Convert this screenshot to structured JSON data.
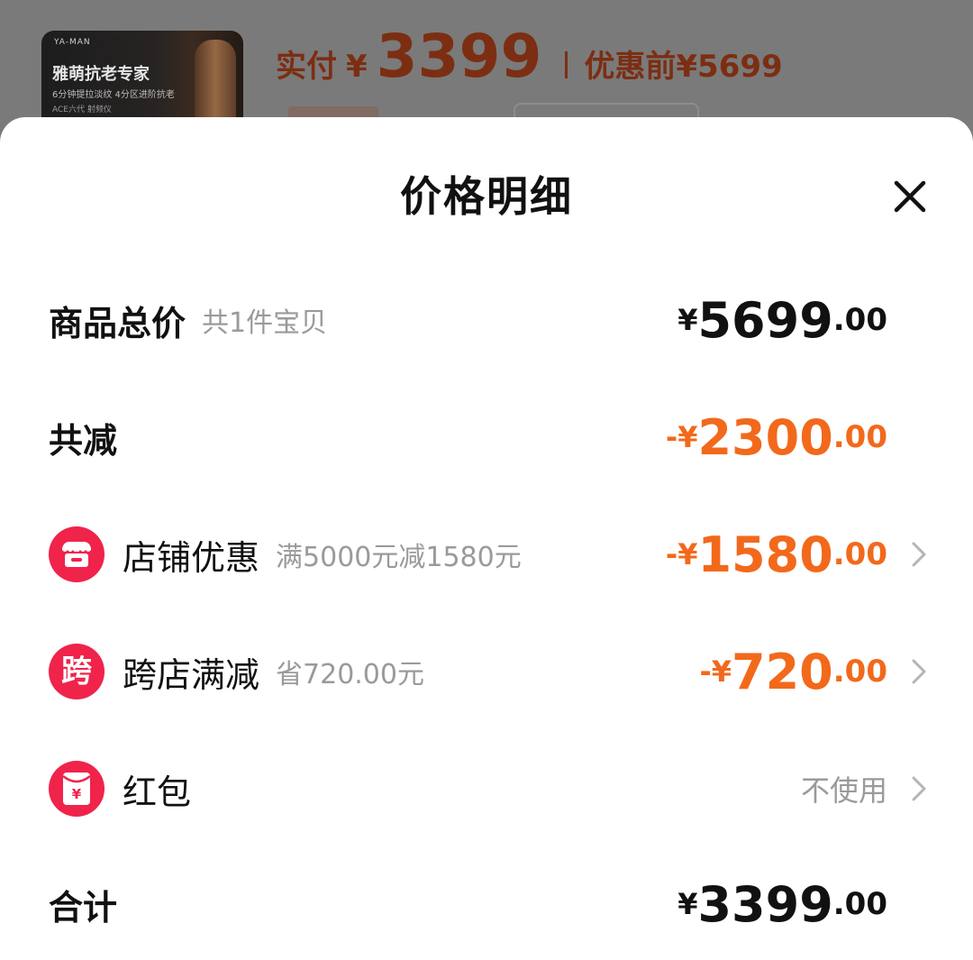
{
  "background": {
    "product": {
      "brand": "YA-MAN",
      "title": "雅萌抗老专家",
      "line1": "6分钟提拉淡纹 4分区进阶抗老",
      "line2": "ACE六代 射频仪"
    },
    "price_bar": {
      "paid_label": "实付",
      "currency": "¥",
      "paid_amount": "3399",
      "before_label": "优惠前",
      "before_amount": "¥5699"
    }
  },
  "sheet": {
    "title": "价格明细",
    "close_icon": "close-icon",
    "rows": {
      "total_goods": {
        "label": "商品总价",
        "sub": "共1件宝贝",
        "currency": "¥",
        "int": "5699",
        "dec": ".00"
      },
      "total_discount": {
        "label": "共减",
        "currency": "-¥",
        "int": "2300",
        "dec": ".00"
      },
      "shop_discount": {
        "icon": "shop-icon",
        "label": "店铺优惠",
        "sub": "满5000元减1580元",
        "currency": "-¥",
        "int": "1580",
        "dec": ".00"
      },
      "cross_store": {
        "icon": "cross-store-icon",
        "icon_glyph": "跨",
        "label": "跨店满减",
        "sub": "省720.00元",
        "currency": "-¥",
        "int": "720",
        "dec": ".00"
      },
      "red_packet": {
        "icon": "red-packet-icon",
        "icon_glyph": "¥",
        "label": "红包",
        "value": "不使用"
      },
      "grand_total": {
        "label": "合计",
        "currency": "¥",
        "int": "3399",
        "dec": ".00"
      }
    }
  },
  "colors": {
    "accent_orange": "#f2691b",
    "icon_red": "#f0234b",
    "muted_text": "#9a9a9a"
  }
}
